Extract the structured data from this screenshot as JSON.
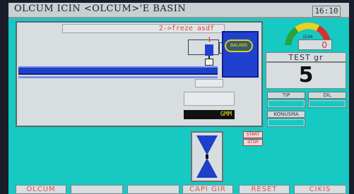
{
  "window": {
    "title": "OLCUM ICIN <OLCUM>'E BASIN",
    "clock": "16:10"
  },
  "machine_panel": {
    "banner": "2->freze asdf",
    "marker": "1",
    "device_label": "BALANS",
    "gmm_label": "GMM"
  },
  "speed_gauge": {
    "unit": "D/dk",
    "value": "0"
  },
  "test": {
    "label": "TEST gr",
    "value": "5"
  },
  "settings": {
    "tip_label": "TIP",
    "dil_label": "DIL",
    "konusma_label": "KONUSMA"
  },
  "controls": {
    "start_label": "START",
    "stop_label": "STOP"
  },
  "function_keys": [
    "OLCUM",
    "",
    "",
    "CAPI GIR",
    "RESET",
    "CIKIS"
  ],
  "colors": {
    "screen": "#16c9c2",
    "conveyor": "#1e3fc8",
    "alert": "#e05050"
  }
}
